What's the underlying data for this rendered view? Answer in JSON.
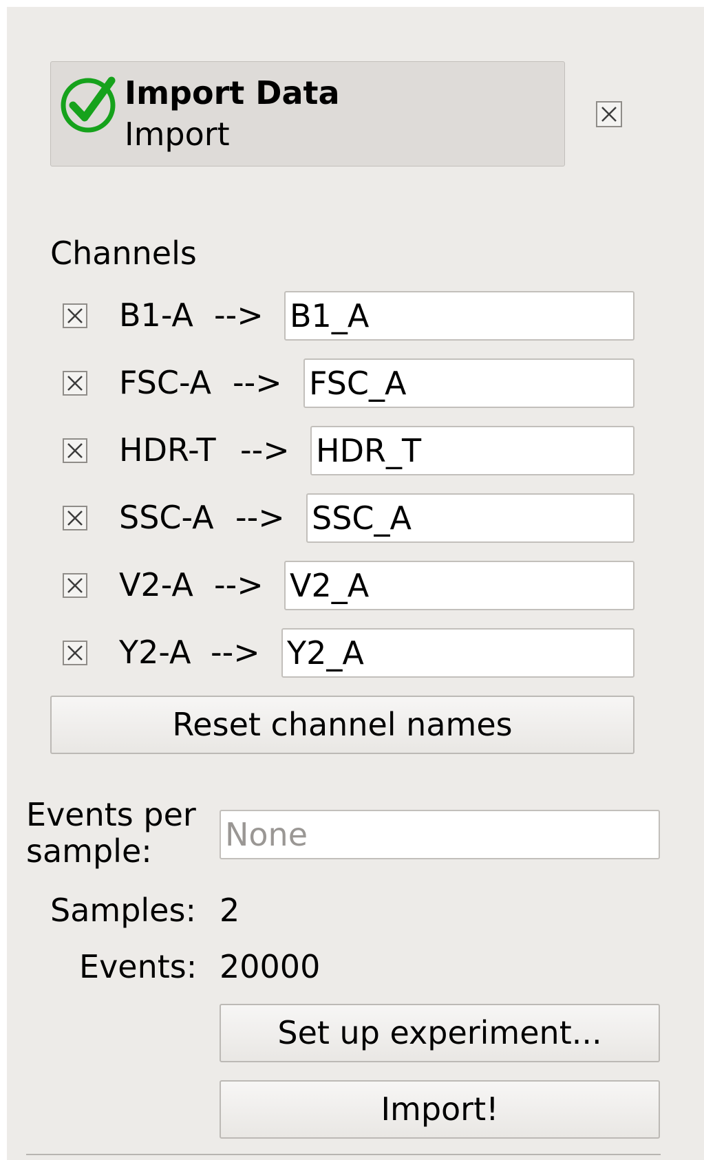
{
  "header": {
    "title": "Import Data",
    "subtitle": "Import",
    "status_icon": "check-circle-icon",
    "close_icon": "close-icon",
    "accent_color": "#16a21c"
  },
  "channels": {
    "section_label": "Channels",
    "arrow": "-->",
    "rows": [
      {
        "source": "B1-A",
        "target": "B1_A",
        "checked": true
      },
      {
        "source": "FSC-A",
        "target": "FSC_A",
        "checked": true
      },
      {
        "source": "HDR-T",
        "target": "HDR_T",
        "checked": true
      },
      {
        "source": "SSC-A",
        "target": "SSC_A",
        "checked": true
      },
      {
        "source": "V2-A",
        "target": "V2_A",
        "checked": true
      },
      {
        "source": "Y2-A",
        "target": "Y2_A",
        "checked": true
      }
    ],
    "reset_label": "Reset channel names"
  },
  "events_per_sample": {
    "label": "Events per sample:",
    "label_line1": "Events per",
    "label_line2": "sample:",
    "value": "",
    "placeholder": "None"
  },
  "stats": {
    "samples_label": "Samples:",
    "samples_value": "2",
    "events_label": "Events:",
    "events_value": "20000"
  },
  "actions": {
    "setup_label": "Set up experiment...",
    "import_label": "Import!"
  }
}
